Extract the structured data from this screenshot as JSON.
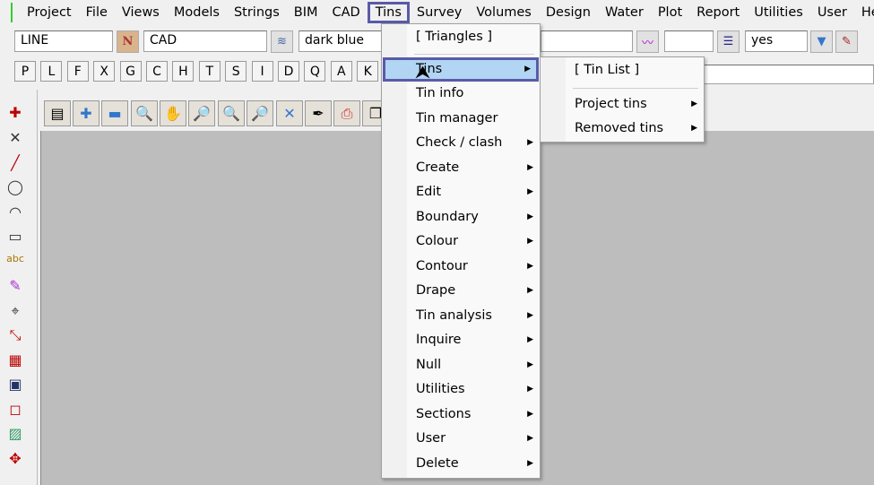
{
  "menubar": {
    "items": [
      "Project",
      "File",
      "Views",
      "Models",
      "Strings",
      "BIM",
      "CAD",
      "Tins",
      "Survey",
      "Volumes",
      "Design",
      "Water",
      "Plot",
      "Report",
      "Utilities",
      "User",
      "He"
    ],
    "selected": "Tins"
  },
  "toolbar": {
    "string_type": "LINE",
    "model": "CAD",
    "colour": "dark blue",
    "style": "",
    "weight": "",
    "visible": "yes",
    "n_label": "N"
  },
  "letters": [
    "P",
    "L",
    "F",
    "X",
    "G",
    "C",
    "H",
    "T",
    "S",
    "I",
    "D",
    "Q",
    "A",
    "K"
  ],
  "tins_menu": {
    "items": [
      {
        "label": "[ Triangles ]",
        "sub": false
      },
      {
        "label": "Tins",
        "sub": true
      },
      {
        "label": "Tin info",
        "sub": false
      },
      {
        "label": "Tin manager",
        "sub": false
      },
      {
        "label": "Check / clash",
        "sub": true
      },
      {
        "label": "Create",
        "sub": true
      },
      {
        "label": "Edit",
        "sub": true
      },
      {
        "label": "Boundary",
        "sub": true
      },
      {
        "label": "Colour",
        "sub": true
      },
      {
        "label": "Contour",
        "sub": true
      },
      {
        "label": "Drape",
        "sub": true
      },
      {
        "label": "Tin analysis",
        "sub": true
      },
      {
        "label": "Inquire",
        "sub": true
      },
      {
        "label": "Null",
        "sub": true
      },
      {
        "label": "Utilities",
        "sub": true
      },
      {
        "label": "Sections",
        "sub": true
      },
      {
        "label": "User",
        "sub": true
      },
      {
        "label": "Delete",
        "sub": true
      }
    ]
  },
  "tins_submenu": {
    "items": [
      {
        "label": "[ Tin List ]",
        "sub": false
      },
      {
        "label": "Project tins",
        "sub": true
      },
      {
        "label": "Removed tins",
        "sub": true
      }
    ]
  },
  "colors": {
    "highlight": "#b1d5f2",
    "focus_border": "#5a5aa8",
    "canvas": "#bdbdbd"
  }
}
